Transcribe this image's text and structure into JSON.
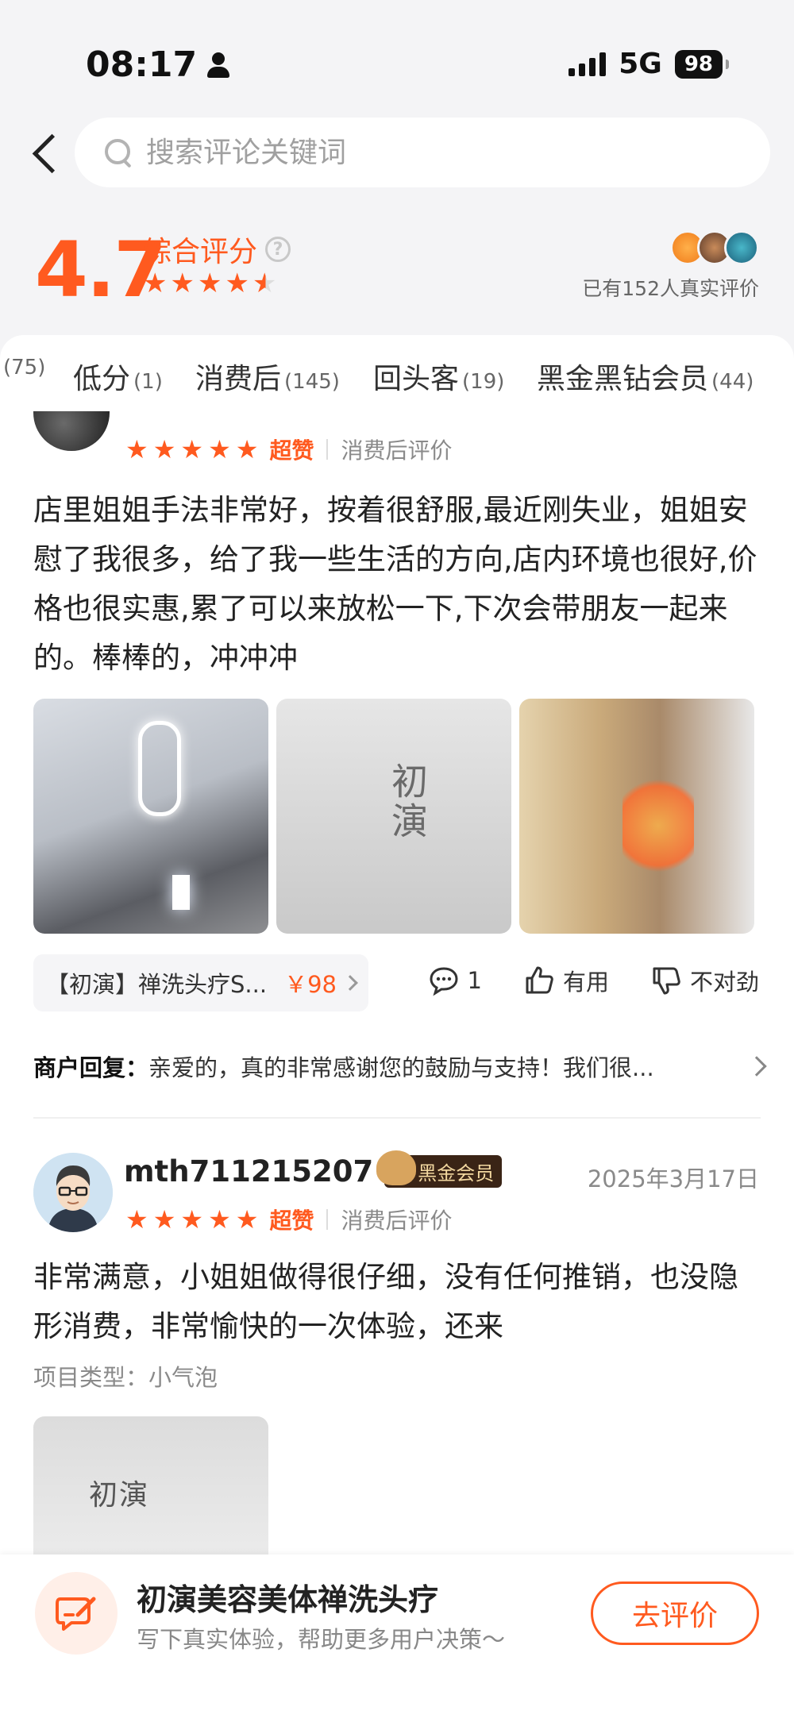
{
  "status_bar": {
    "time": "08:17",
    "network": "5G",
    "battery": "98"
  },
  "search": {
    "placeholder": "搜索评论关键词"
  },
  "rating": {
    "score": "4.7",
    "label": "综合评分",
    "help": "?",
    "stars": 4.7,
    "review_count": "已有152人真实评价"
  },
  "tabs": [
    {
      "label": "",
      "count": "(75)"
    },
    {
      "label": "低分",
      "count": "(1)"
    },
    {
      "label": "消费后",
      "count": "(145)"
    },
    {
      "label": "回头客",
      "count": "(19)"
    },
    {
      "label": "黑金黑钻会员",
      "count": "(44)"
    }
  ],
  "reviews": [
    {
      "rating_word": "超赞",
      "source": "消费后评价",
      "text": "店里姐姐手法非常好，按着很舒服,最近刚失业，姐姐安慰了我很多，给了我一些生活的方向,店内环境也很好,价格也很实惠,累了可以来放松一下,下次会带朋友一起来的。棒棒的，冲冲冲",
      "photo_text": "初演",
      "product": {
        "name": "【初演】禅洗头疗S...",
        "price": "￥98"
      },
      "actions": {
        "comments": "1",
        "useful": "有用",
        "wrong": "不对劲"
      },
      "reply": {
        "label": "商户回复：",
        "text": "亲爱的，真的非常感谢您的鼓励与支持！我们很..."
      }
    },
    {
      "user": "mth711215207",
      "badge": "黑金会员",
      "date": "2025年3月17日",
      "rating_word": "超赞",
      "source": "消费后评价",
      "text": "非常满意，小姐姐做得很仔细，没有任何推销，也没隐形消费，非常愉快的一次体验，还来",
      "project_type": "项目类型：小气泡",
      "photo_text": "初演"
    }
  ],
  "bottom_bar": {
    "title": "初演美容美体禅洗头疗",
    "subtitle": "写下真实体验，帮助更多用户决策～",
    "button": "去评价"
  },
  "colors": {
    "accent": "#ff5a1f",
    "badge_bg": "#3a2416",
    "badge_text": "#f3d8a0"
  },
  "icons": [
    "back-arrow-icon",
    "search-icon",
    "help-icon",
    "star-icon",
    "comment-icon",
    "thumbs-up-icon",
    "thumbs-down-icon",
    "chevron-right-icon",
    "edit-review-icon"
  ]
}
